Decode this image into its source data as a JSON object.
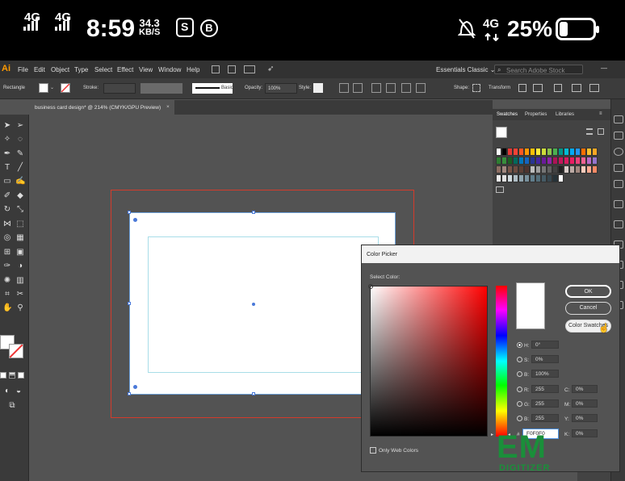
{
  "status_bar": {
    "net1": "4G",
    "net2": "4G",
    "time": "8:59",
    "speed_value": "34.3",
    "speed_unit": "KB/S",
    "net3": "4G",
    "battery": "25%",
    "battery_level": 0.25
  },
  "app": {
    "logo": "Ai",
    "menus": [
      "File",
      "Edit",
      "Object",
      "Type",
      "Select",
      "Effect",
      "View",
      "Window",
      "Help"
    ],
    "workspace": "Essentials Classic",
    "search_placeholder": "Search Adobe Stock"
  },
  "control_bar": {
    "object_type": "Rectangle",
    "stroke_label": "Stroke:",
    "brush": "Basic",
    "opacity_label": "Opacity:",
    "opacity_value": "100%",
    "style_label": "Style:",
    "shape_label": "Shape:",
    "transform_label": "Transform"
  },
  "document_tab": {
    "title": "business card design* @ 214% (CMYK/GPU Preview)",
    "close": "×"
  },
  "panels": {
    "tabs": [
      "Swatches",
      "Properties",
      "Libraries"
    ]
  },
  "color_picker": {
    "title": "Color Picker",
    "select_color_label": "Select Color:",
    "ok": "OK",
    "cancel": "Cancel",
    "color_swatches": "Color Swatches",
    "hsb": [
      {
        "label": "H:",
        "value": "0°"
      },
      {
        "label": "S:",
        "value": "0%"
      },
      {
        "label": "B:",
        "value": "100%"
      }
    ],
    "rgb": [
      {
        "label": "R:",
        "value": "255"
      },
      {
        "label": "G:",
        "value": "255"
      },
      {
        "label": "B:",
        "value": "255"
      }
    ],
    "cmyk": [
      {
        "label": "C:",
        "value": "0%"
      },
      {
        "label": "M:",
        "value": "0%"
      },
      {
        "label": "Y:",
        "value": "0%"
      },
      {
        "label": "K:",
        "value": "0%"
      }
    ],
    "hex_label": "#",
    "hex_value": "F0F0F0",
    "only_web_colors": "Only Web Colors"
  },
  "watermark": {
    "big": "EM",
    "small": "DIGITIZER"
  },
  "colors": {
    "app_bg": "#535353",
    "bleed": "#d43b2b",
    "guide": "#a8dde8",
    "accent_orange": "#ff9a00",
    "watermark_green": "#1a8f3a"
  }
}
